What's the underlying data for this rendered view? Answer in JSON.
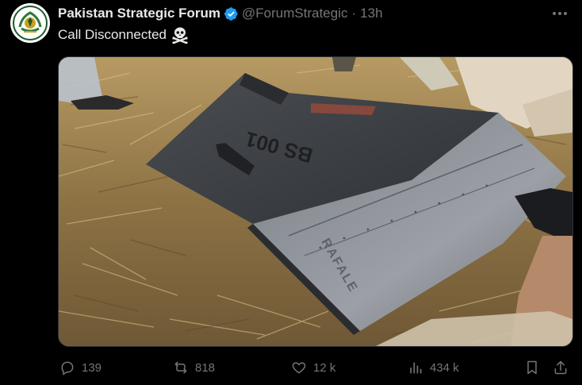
{
  "post": {
    "author_name": "Pakistan Strategic Forum",
    "handle": "@ForumStrategic",
    "separator": "·",
    "time_ago": "13h",
    "text": "Call Disconnected",
    "emoji_icon": "skull-crossbones-icon"
  },
  "media": {
    "stencil_left": "BS 001",
    "stencil_right": "RAFALE"
  },
  "actions": {
    "replies": "139",
    "reposts": "818",
    "likes": "12 k",
    "views": "434 k"
  },
  "colors": {
    "background": "#000000",
    "text_primary": "#e7e9ea",
    "text_secondary": "#71767b",
    "verified_blue": "#1d9bf0"
  }
}
